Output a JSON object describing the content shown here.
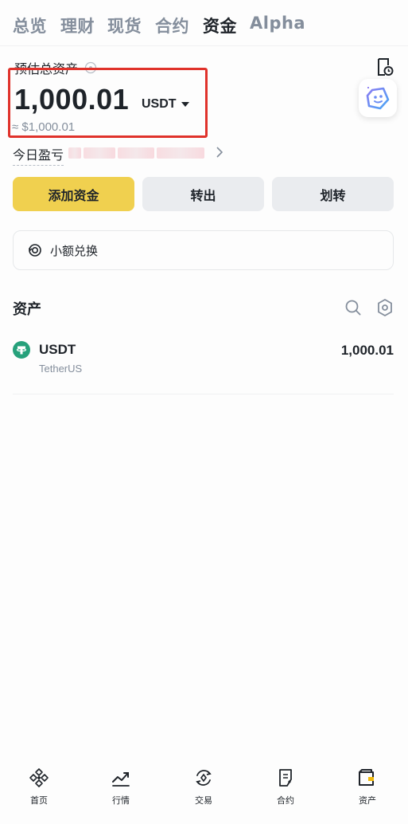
{
  "top_tabs": [
    {
      "label": "总览",
      "active": false
    },
    {
      "label": "理财",
      "active": false
    },
    {
      "label": "现货",
      "active": false
    },
    {
      "label": "合约",
      "active": false
    },
    {
      "label": "资金",
      "active": true
    },
    {
      "label": "Alpha",
      "active": false
    }
  ],
  "balance": {
    "label": "预估总资产",
    "amount": "1,000.01",
    "currency": "USDT",
    "fiat": "≈ $1,000.01"
  },
  "pnl": {
    "label": "今日盈亏"
  },
  "actions": {
    "add_funds": "添加资金",
    "transfer_out": "转出",
    "transfer": "划转"
  },
  "convert": {
    "label": "小额兑换"
  },
  "assets_section": {
    "title": "资产"
  },
  "assets": [
    {
      "symbol": "USDT",
      "name": "TetherUS",
      "amount": "1,000.01",
      "icon": "tether-icon",
      "color": "#26a17b"
    }
  ],
  "bottom_nav": [
    {
      "label": "首页",
      "icon": "home-icon"
    },
    {
      "label": "行情",
      "icon": "markets-icon"
    },
    {
      "label": "交易",
      "icon": "trade-icon"
    },
    {
      "label": "合约",
      "icon": "futures-icon"
    },
    {
      "label": "资产",
      "icon": "wallet-icon",
      "active": true
    }
  ],
  "colors": {
    "accent": "#f0d04f",
    "text": "#1e2329",
    "muted": "#848e9c",
    "highlight": "#e0322b"
  }
}
